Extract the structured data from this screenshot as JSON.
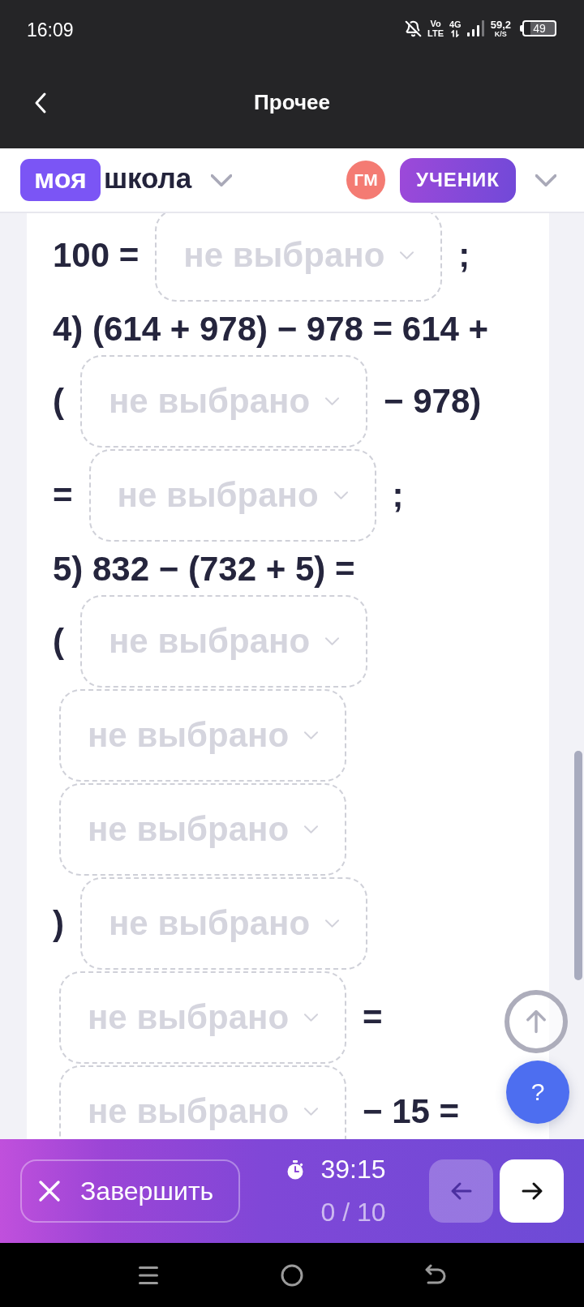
{
  "status_bar": {
    "time": "16:09",
    "volte": [
      "Vo",
      "LTE"
    ],
    "network": "4G",
    "speed": "59,2",
    "speed_unit": "K/S",
    "battery": "49"
  },
  "app_bar": {
    "title": "Прочее"
  },
  "header": {
    "logo_badge": "моя",
    "logo_text": "школа",
    "avatar_initials": "ГМ",
    "role": "УЧЕНИК"
  },
  "task": {
    "lines": [
      {
        "tokens": [
          {
            "kind": "text",
            "text": "100 ="
          },
          {
            "kind": "select",
            "placeholder": "не выбрано"
          },
          {
            "kind": "text",
            "text": ";"
          }
        ]
      },
      {
        "tokens": [
          {
            "kind": "text",
            "text": "4) (614 + 978) − 978 = 614 +"
          }
        ]
      },
      {
        "tokens": [
          {
            "kind": "text",
            "text": "("
          },
          {
            "kind": "select",
            "placeholder": "не выбрано"
          },
          {
            "kind": "text",
            "text": "− 978)"
          }
        ]
      },
      {
        "tokens": [
          {
            "kind": "text",
            "text": "="
          },
          {
            "kind": "select",
            "placeholder": "не выбрано"
          },
          {
            "kind": "text",
            "text": ";"
          }
        ]
      },
      {
        "tokens": [
          {
            "kind": "text",
            "text": "5) 832 − (732 + 5) ="
          }
        ]
      },
      {
        "tokens": [
          {
            "kind": "text",
            "text": "("
          },
          {
            "kind": "select",
            "placeholder": "не выбрано"
          }
        ]
      },
      {
        "tokens": [
          {
            "kind": "select",
            "placeholder": "не выбрано"
          }
        ]
      },
      {
        "tokens": [
          {
            "kind": "select",
            "placeholder": "не выбрано"
          }
        ]
      },
      {
        "tokens": [
          {
            "kind": "text",
            "text": ")"
          },
          {
            "kind": "select",
            "placeholder": "не выбрано"
          }
        ]
      },
      {
        "tokens": [
          {
            "kind": "select",
            "placeholder": "не выбрано"
          },
          {
            "kind": "text",
            "text": "="
          }
        ]
      },
      {
        "tokens": [
          {
            "kind": "select",
            "placeholder": "не выбрано"
          },
          {
            "kind": "text",
            "text": "− 15 ="
          }
        ]
      }
    ]
  },
  "bottom_bar": {
    "finish_button": {
      "label": "Завершить"
    },
    "timer": "39:15",
    "progress": "0 / 10",
    "previous_button": {
      "disabled": true
    },
    "next_button": {
      "disabled": false
    }
  },
  "help_button": {
    "label": "?"
  }
}
